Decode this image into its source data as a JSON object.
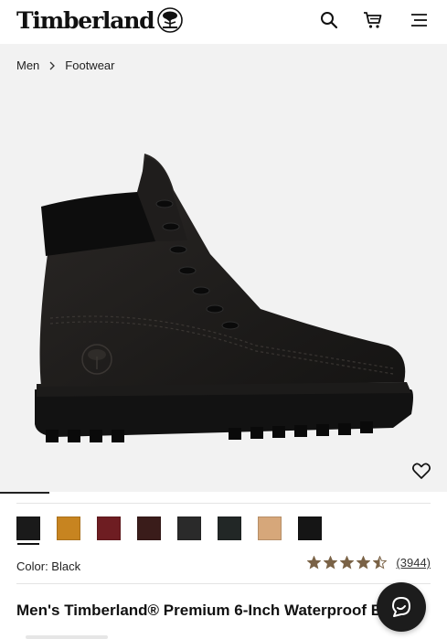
{
  "header": {
    "brand": "Timberland",
    "icons": [
      "tree-logo-icon",
      "search-icon",
      "cart-icon",
      "menu-icon"
    ]
  },
  "breadcrumb": {
    "items": [
      "Men",
      "Footwear"
    ]
  },
  "product": {
    "color_label": "Color: Black",
    "rating": {
      "stars": 4.5,
      "max": 5,
      "review_count": "(3944)"
    },
    "title": "Men's Timberland® Premium 6-Inch Waterproof Boots"
  },
  "swatches": {
    "selected_index": 0,
    "colors": [
      "#1a1a1a",
      "#c78420",
      "#6e1d22",
      "#3a1c1a",
      "#2a2a2a",
      "#222726",
      "#d6a77a",
      "#151515"
    ]
  },
  "colors": {
    "star": "#7a6246",
    "gallery_bg": "#f2f2f2",
    "chat_bg": "#1c1c1c"
  }
}
